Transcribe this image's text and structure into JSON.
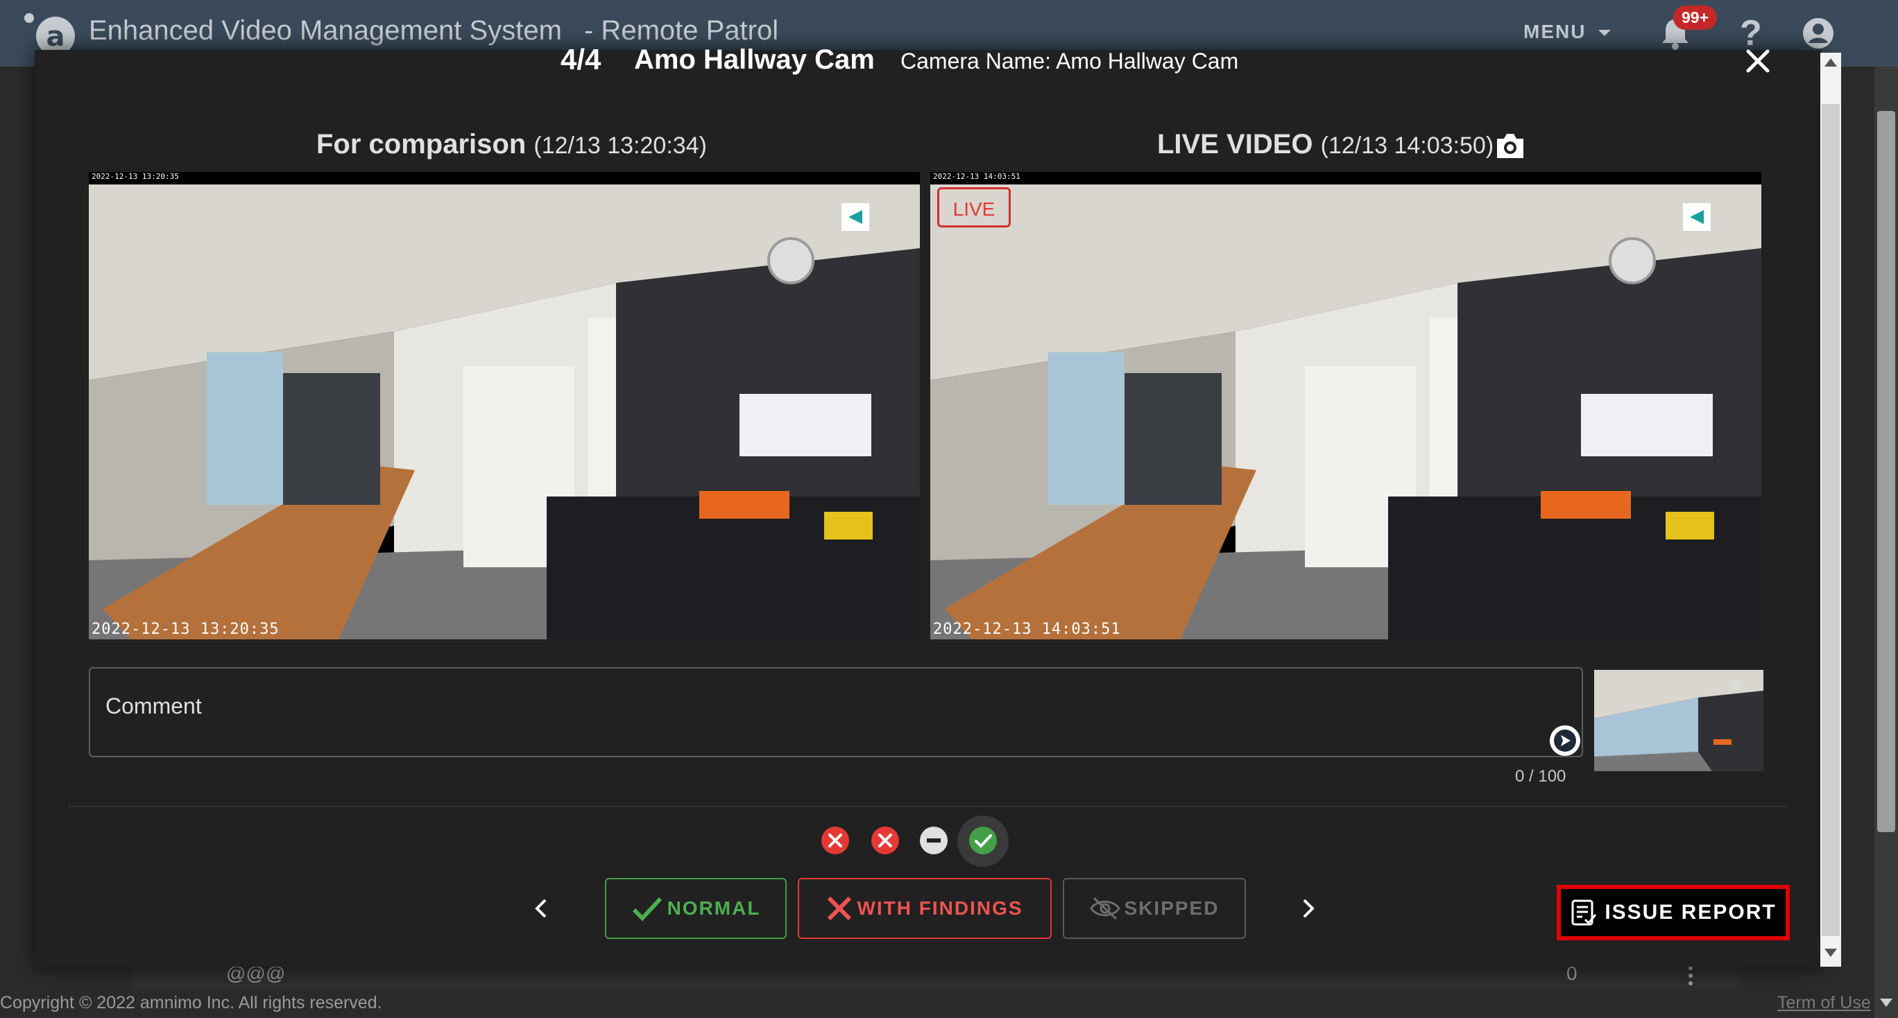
{
  "app": {
    "title": "Enhanced Video Management System",
    "subtitle": "- Remote Patrol",
    "menu_label": "MENU",
    "notification_badge": "99+"
  },
  "background": {
    "row_name": "@@@",
    "row_count": "0",
    "copyright": "Copyright © 2022 amnimo Inc. All rights reserved.",
    "terms_link": "Term of Use"
  },
  "modal": {
    "count": "4/4",
    "camera_title": "Amo Hallway Cam",
    "camera_name_line": "Camera Name: Amo Hallway Cam",
    "comparison": {
      "heading": "For comparison",
      "timestamp": "(12/13 13:20:34)",
      "top_overlay": "2022-12-13 13:20:35",
      "bottom_overlay": "2022-12-13 13:20:35"
    },
    "live": {
      "heading": "LIVE VIDEO",
      "timestamp": "(12/13 14:03:50)",
      "live_tag": "LIVE",
      "top_overlay": "2022-12-13 14:03:51",
      "bottom_overlay": "2022-12-13 14:03:51"
    },
    "comment": {
      "placeholder": "Comment",
      "value": "",
      "counter": "0 / 100"
    },
    "status_icons": [
      "error-icon",
      "error-icon",
      "minus-circle-icon",
      "check-circle-icon"
    ],
    "buttons": {
      "normal": "NORMAL",
      "with_findings": "WITH FINDINGS",
      "skipped": "SKIPPED",
      "issue_report": "ISSUE REPORT"
    }
  },
  "colors": {
    "appbar": "#3b4a5a",
    "normal": "#4caf50",
    "findings": "#ef5350",
    "highlight": "#e00000"
  }
}
